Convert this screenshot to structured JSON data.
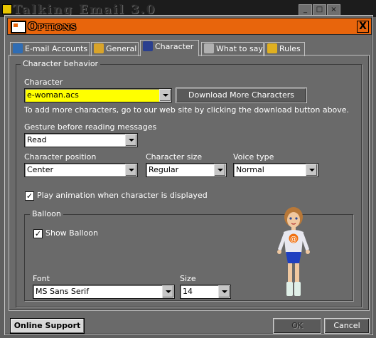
{
  "background_app": {
    "title": "Talking Email 3.0"
  },
  "dialog": {
    "title": "Options",
    "close_symbol": "X"
  },
  "tabs": [
    {
      "label": "E-mail Accounts",
      "icon": "mailbox-icon"
    },
    {
      "label": "General",
      "icon": "people-icon"
    },
    {
      "label": "Character",
      "icon": "wizard-icon"
    },
    {
      "label": "What to say",
      "icon": "speech-icon"
    },
    {
      "label": "Rules",
      "icon": "rules-icon"
    }
  ],
  "character_behavior": {
    "group_label": "Character behavior",
    "character_label": "Character",
    "character_value": "e-woman.acs",
    "download_button": "Download More Characters",
    "help_text": "To add more characters, go to our web site by clicking the download button above.",
    "gesture_label": "Gesture before reading messages",
    "gesture_value": "Read",
    "position_label": "Character position",
    "position_value": "Center",
    "size_label": "Character size",
    "size_value": "Regular",
    "voice_label": "Voice type",
    "voice_value": "Normal",
    "play_animation_label": "Play animation when character is displayed",
    "play_animation_checked": true
  },
  "balloon": {
    "group_label": "Balloon",
    "show_balloon_label": "Show Balloon",
    "show_balloon_checked": true,
    "font_label": "Font",
    "font_value": "MS Sans Serif",
    "size_label": "Size",
    "size_value": "14"
  },
  "footer": {
    "online_support": "Online Support",
    "ok": "OK",
    "cancel": "Cancel"
  },
  "colors": {
    "title_bar": "#e8650c",
    "dialog_bg": "#6a6a6a",
    "character_field_bg": "#ffff00"
  }
}
